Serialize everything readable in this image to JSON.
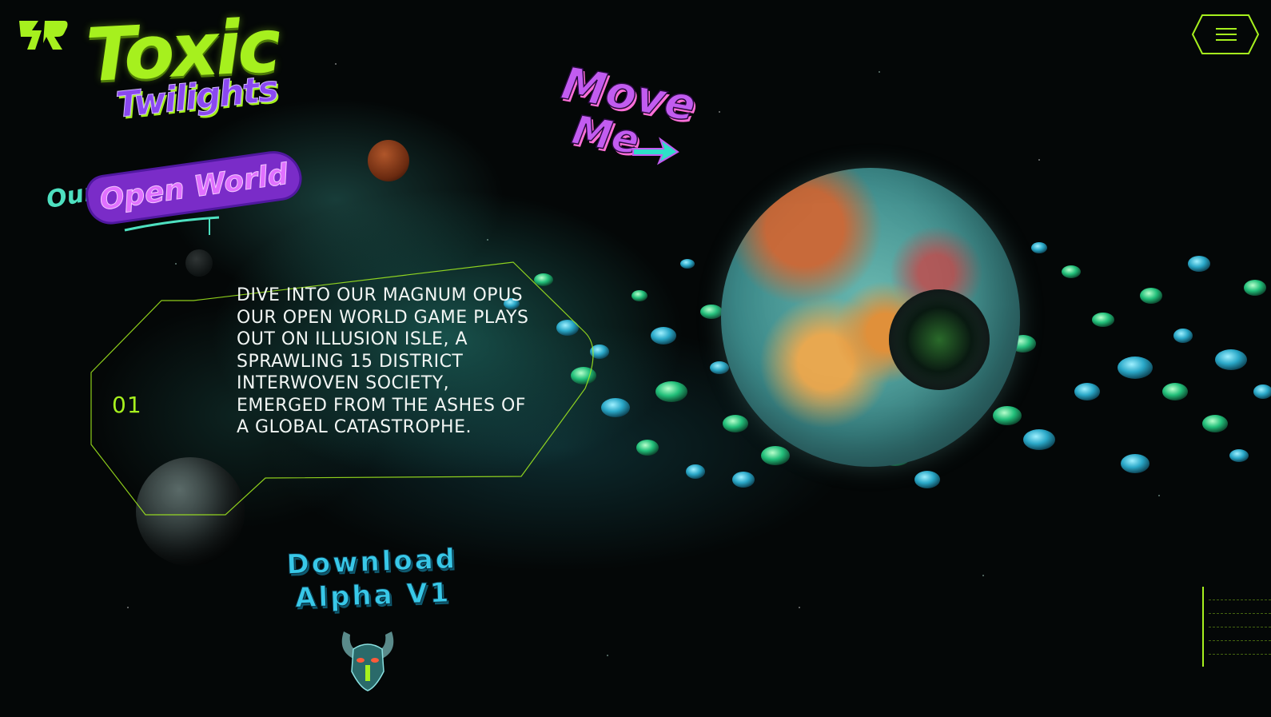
{
  "brand": {
    "logo_icon": "sr-monogram-icon",
    "title_line1": "Toxic",
    "title_line2": "Twilights"
  },
  "header": {
    "menu_icon": "hamburger-menu-icon"
  },
  "sticker": {
    "line1": "Move",
    "line2": "Me"
  },
  "section": {
    "kicker": "Our",
    "heading": "Open World"
  },
  "feature_panel": {
    "number": "01",
    "text": "Dive into our magnum opus our open world game plays out on Illusion Isle, a sprawling 15 district interwoven society, emerged from the ashes of a global catastrophe."
  },
  "cta": {
    "line1": "Download",
    "line2": "Alpha V1",
    "icon": "horned-mask-icon"
  },
  "colors": {
    "accent": "#a6f01e",
    "purple": "#8a48f0",
    "cyan": "#38c8e8",
    "background": "#040707"
  }
}
